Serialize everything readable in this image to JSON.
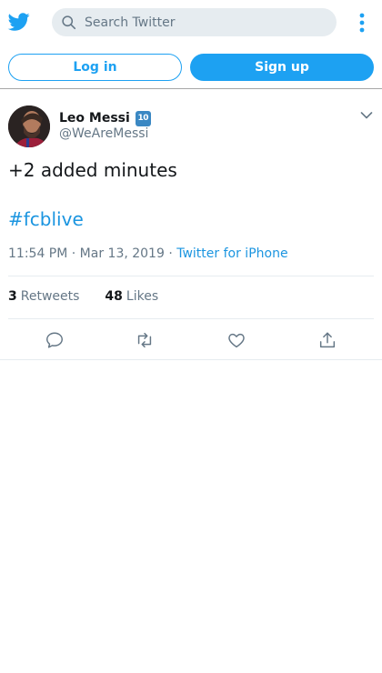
{
  "header": {
    "logo_icon": "twitter-bird-icon",
    "search": {
      "placeholder": "Search Twitter",
      "value": ""
    },
    "more_icon": "vertical-ellipsis-icon"
  },
  "auth": {
    "login_label": "Log in",
    "signup_label": "Sign up"
  },
  "tweet": {
    "author_name": "Leo Messi",
    "author_badge": "10",
    "author_handle": "@WeAreMessi",
    "text": "+2 added minutes",
    "hashtag": "#fcblive",
    "time": "11:54 PM · Mar 13, 2019 · ",
    "source": "Twitter for iPhone",
    "retweets_count": "3",
    "retweets_label": "Retweets",
    "likes_count": "48",
    "likes_label": "Likes",
    "actions": [
      "reply-icon",
      "retweet-icon",
      "like-icon",
      "share-icon"
    ]
  },
  "colors": {
    "brand": "#1da1f2",
    "link": "#1b95e0",
    "muted": "#657786",
    "badge": "#3b88c3"
  }
}
